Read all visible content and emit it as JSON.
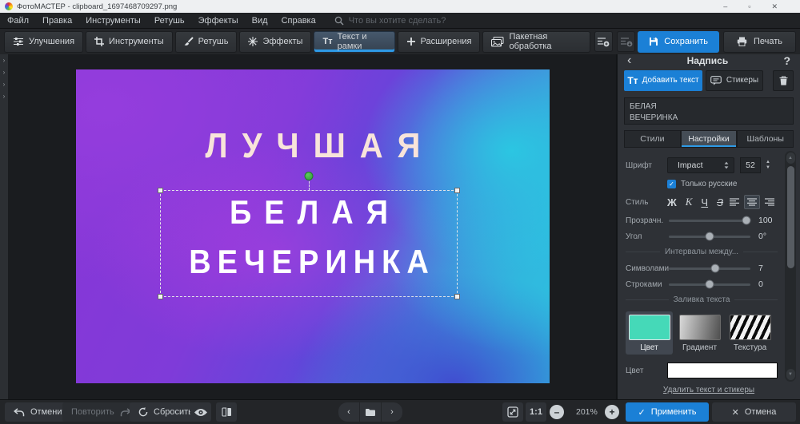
{
  "window": {
    "title": "ФотоМАСТЕР - clipboard_1697468709297.png",
    "minimize": "–",
    "maximize": "▫",
    "close": "✕"
  },
  "menu": {
    "items": [
      "Файл",
      "Правка",
      "Инструменты",
      "Ретушь",
      "Эффекты",
      "Вид",
      "Справка"
    ],
    "search_placeholder": "Что вы хотите сделать?"
  },
  "toolbar": {
    "tabs": [
      "Улучшения",
      "Инструменты",
      "Ретушь",
      "Эффекты",
      "Текст и рамки",
      "Расширения",
      "Пакетная обработка"
    ],
    "active_tab": "Текст и рамки",
    "text_tab_icon": "Тт",
    "save": "Сохранить",
    "print": "Печать"
  },
  "canvas": {
    "title_text": "ЛУЧШАЯ",
    "selected_line1": "БЕЛАЯ",
    "selected_line2": "ВЕЧЕРИНКА"
  },
  "panel": {
    "back": "‹",
    "title": "Надпись",
    "help": "?",
    "add_text_icon": "Тт",
    "add_text": "Добавить текст",
    "stickers": "Стикеры",
    "text_value": "БЕЛАЯ\nВЕЧЕРИНКА",
    "tabs": [
      "Стили",
      "Настройки",
      "Шаблоны"
    ],
    "active_tab": "Настройки",
    "font_label": "Шрифт",
    "font_family": "Impact",
    "font_size": "52",
    "only_russian": "Только русские",
    "only_russian_checked": true,
    "check_glyph": "✓",
    "style_label": "Стиль",
    "style_bold": "Ж",
    "style_italic": "К",
    "style_underline": "Ч",
    "style_strike": "З",
    "opacity_label": "Прозрачн.",
    "opacity_value": "100",
    "angle_label": "Угол",
    "angle_value": "0°",
    "intervals_divider": "Интервалы между...",
    "chars_label": "Символами",
    "chars_value": "7",
    "lines_label": "Строками",
    "lines_value": "0",
    "fill_divider": "Заливка текста",
    "fill_options": [
      "Цвет",
      "Градиент",
      "Текстура"
    ],
    "fill_selected": "Цвет",
    "teal_swatch_hex": "#45d9b8",
    "color_label": "Цвет",
    "fill_color_hex": "#ffffff",
    "delete_link": "Удалить текст и стикеры",
    "accent_hex": "#1b80d6"
  },
  "bottombar": {
    "undo": "Отменить",
    "redo": "Повторить",
    "reset": "Сбросить",
    "one_to_one": "1:1",
    "zoom_out": "–",
    "zoom_level": "201%",
    "zoom_in": "+",
    "apply": "Применить",
    "apply_icon": "✓",
    "cancel": "Отмена",
    "cancel_icon": "✕"
  }
}
